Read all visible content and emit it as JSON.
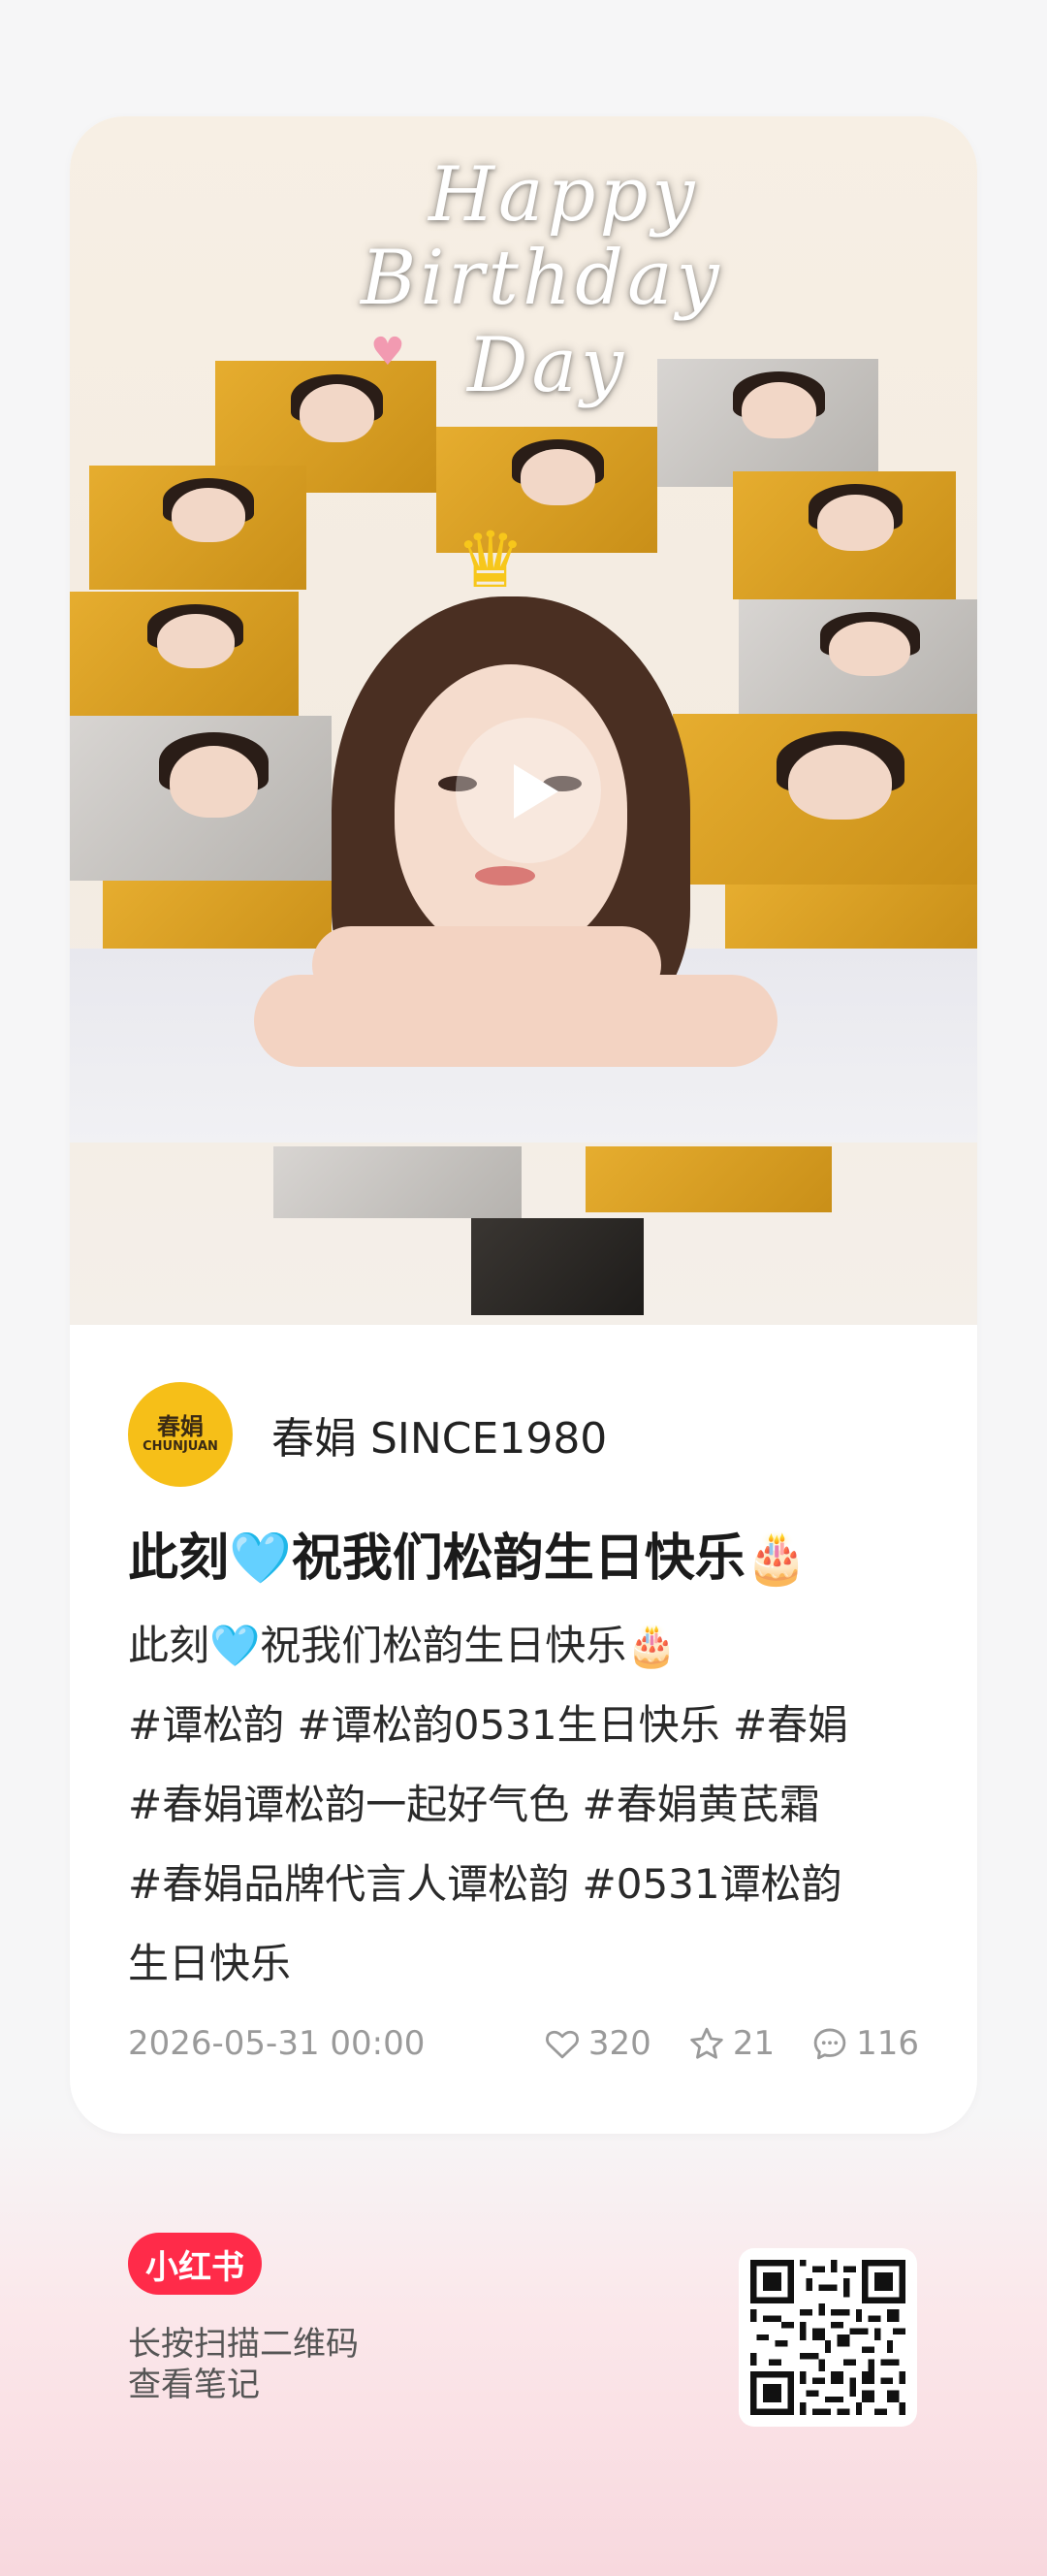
{
  "cover": {
    "overlay_lines": [
      "Happy",
      "Birthday",
      "Day"
    ],
    "has_video": true
  },
  "author": {
    "avatar_line1": "春娟",
    "avatar_line2": "CHUNJUAN",
    "name": "春娟 SINCE1980"
  },
  "post": {
    "title": "此刻🩵祝我们松韵生日快乐🎂",
    "lines": [
      "此刻🩵祝我们松韵生日快乐🎂",
      "#谭松韵 #谭松韵0531生日快乐 #春娟",
      "#春娟谭松韵一起好气色 #春娟黄芪霜",
      "#春娟品牌代言人谭松韵 #0531谭松韵",
      "生日快乐"
    ],
    "date": "2026-05-31 00:00",
    "likes": "320",
    "collects": "21",
    "comments": "116"
  },
  "footer": {
    "logo": "小红书",
    "scan_line1": "长按扫描二维码",
    "scan_line2": "查看笔记"
  },
  "colors": {
    "brand_red": "#ff2b49",
    "avatar_yellow": "#f6bf18",
    "meta_gray": "#9a9a9a"
  }
}
